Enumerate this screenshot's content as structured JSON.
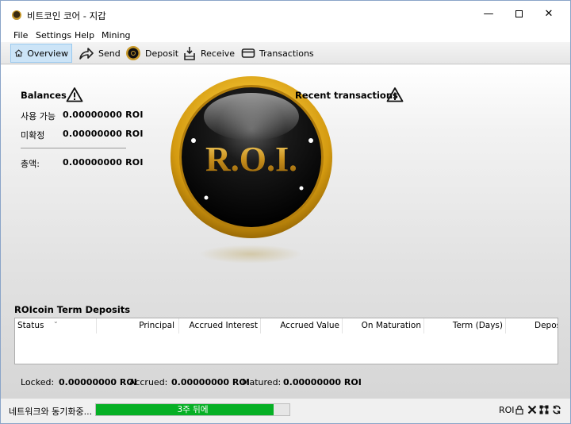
{
  "window": {
    "title": "비트코인 코어 - 지갑",
    "controls": {
      "minimize": "—",
      "close": "✕"
    }
  },
  "menu": [
    "File",
    "Settings",
    "Help",
    "Mining"
  ],
  "toolbar": {
    "overview": "Overview",
    "send": "Send",
    "deposit": "Deposit",
    "receive": "Receive",
    "transactions": "Transactions",
    "active": "Overview"
  },
  "balances": {
    "title": "Balances",
    "available_label": "사용 가능",
    "available_value": "0.00000000 ROI",
    "pending_label": "미확정",
    "pending_value": "0.00000000 ROI",
    "total_label": "총액:",
    "total_value": "0.00000000 ROI"
  },
  "recent": {
    "title": "Recent transactions"
  },
  "logo": {
    "text": "R.O.I."
  },
  "deposits": {
    "title": "ROIcoin Term Deposits",
    "columns": [
      "Status",
      "Principal",
      "Accrued Interest",
      "Accrued Value",
      "On Maturation",
      "Term (Days)",
      "Depos"
    ],
    "rows": []
  },
  "summary": {
    "locked_label": "Locked:",
    "locked_value": "0.00000000 ROI",
    "accrued_label": "Accrued:",
    "accrued_value": "0.00000000 ROI",
    "matured_label": "Matured:",
    "matured_value": "0.00000000 ROI"
  },
  "status": {
    "sync_text": "네트워크와 동기화중...",
    "progress_text": "3주 뒤에",
    "progress_fraction": 0.92,
    "unit": "ROI",
    "progress_color": "#06b025"
  },
  "icons": [
    "app-icon",
    "home-icon",
    "send-arrow-icon",
    "deposit-coin-icon",
    "receive-icon",
    "transactions-card-icon",
    "warning-icon",
    "lock-icon",
    "hd-disabled-icon",
    "network-icon",
    "sync-icon"
  ]
}
